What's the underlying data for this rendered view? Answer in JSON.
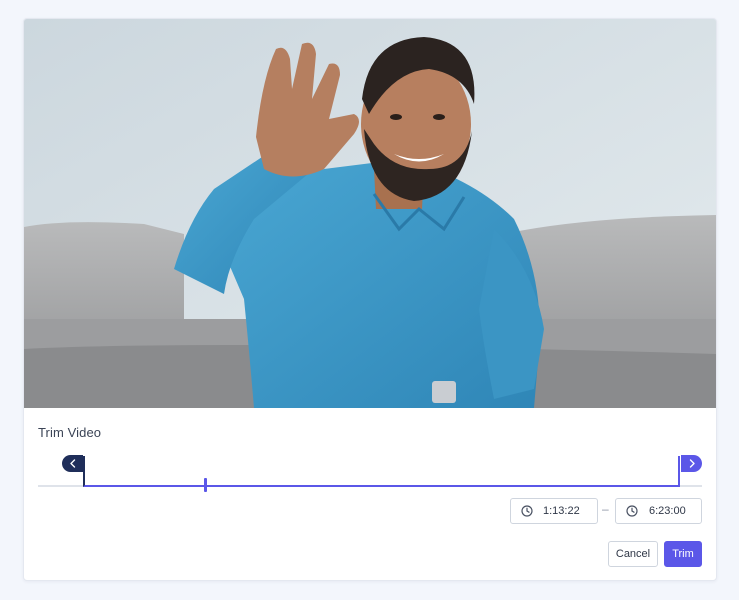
{
  "video": {
    "description_icon": "video-frame-image"
  },
  "trim": {
    "title": "Trim Video",
    "start_time": "1:13:22",
    "end_time": "6:23:00",
    "range_separator": "–",
    "playhead_fraction": 0.21,
    "selection_start_fraction": 0.0,
    "selection_end_fraction": 1.0,
    "left_handle_icon": "chevron-left-icon",
    "right_handle_icon": "chevron-right-icon",
    "time_icon": "clock-icon"
  },
  "actions": {
    "cancel_label": "Cancel",
    "trim_label": "Trim"
  },
  "colors": {
    "accent": "#5b57e8",
    "dark_handle": "#1f2e5a",
    "page_bg": "#f3f6fc"
  }
}
